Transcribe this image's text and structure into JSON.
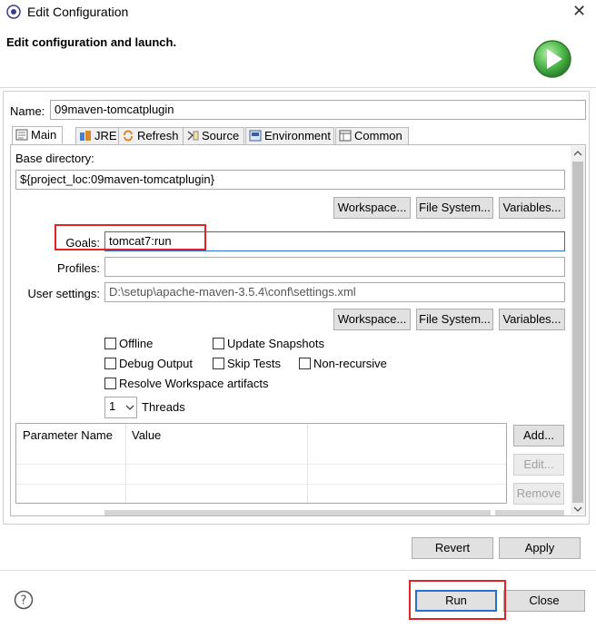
{
  "window": {
    "title": "Edit Configuration",
    "close_glyph": "✕",
    "header_text": "Edit configuration and launch."
  },
  "name_field": {
    "label": "Name:",
    "value": "09maven-tomcatplugin"
  },
  "tabs": [
    {
      "label": "Main",
      "icon": "main-tab-icon"
    },
    {
      "label": "JRE",
      "icon": "jre-icon"
    },
    {
      "label": "Refresh",
      "icon": "refresh-icon"
    },
    {
      "label": "Source",
      "icon": "source-icon"
    },
    {
      "label": "Environment",
      "icon": "environment-icon"
    },
    {
      "label": "Common",
      "icon": "common-icon"
    }
  ],
  "main": {
    "base_directory_label": "Base directory:",
    "base_directory_value": "${project_loc:09maven-tomcatplugin}",
    "workspace_button": "Workspace...",
    "file_system_button": "File System...",
    "variables_button": "Variables...",
    "goals_label": "Goals:",
    "goals_value": "tomcat7:run",
    "profiles_label": "Profiles:",
    "profiles_value": "",
    "user_settings_label": "User settings:",
    "user_settings_value": "D:\\setup\\apache-maven-3.5.4\\conf\\settings.xml",
    "checkboxes": {
      "offline": "Offline",
      "update_snapshots": "Update Snapshots",
      "debug_output": "Debug Output",
      "skip_tests": "Skip Tests",
      "non_recursive": "Non-recursive",
      "resolve_workspace": "Resolve Workspace artifacts"
    },
    "threads_value": "1",
    "threads_label": "Threads",
    "table": {
      "columns": [
        "Parameter Name",
        "Value"
      ]
    },
    "add_button": "Add...",
    "edit_button": "Edit...",
    "remove_button": "Remove"
  },
  "footer": {
    "revert_button": "Revert",
    "apply_button": "Apply",
    "run_button": "Run",
    "close_button": "Close"
  },
  "colors": {
    "highlight_red": "#e02424",
    "focus_blue": "#2a6fcf",
    "run_green": "#3aa83a"
  }
}
